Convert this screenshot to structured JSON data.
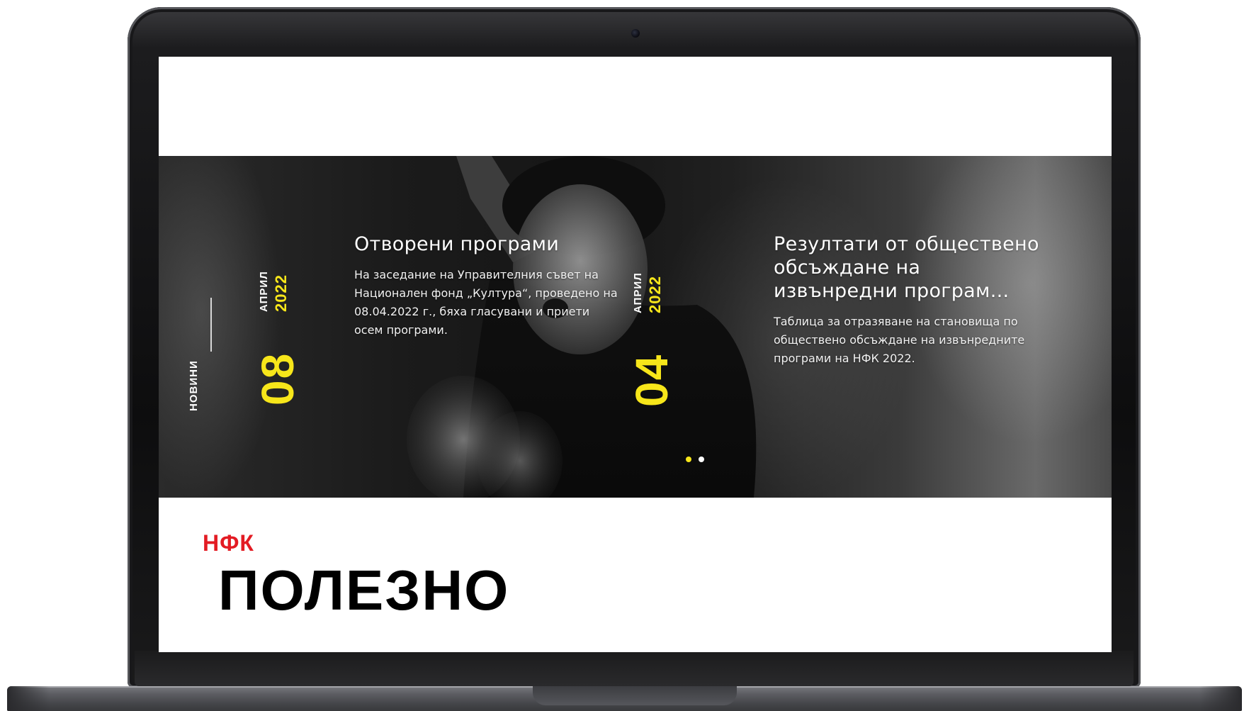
{
  "hero": {
    "section_label": "НОВИНИ",
    "news": [
      {
        "day": "08",
        "month": "АПРИЛ",
        "year": "2022",
        "title": "Отворени програми",
        "text": "На заседание на Управителния съвет на Национален фонд „Култура“, проведено на 08.04.2022 г., бяха гласувани и приети осем програми."
      },
      {
        "day": "04",
        "month": "АПРИЛ",
        "year": "2022",
        "title": "Резултати от обществено обсъждане на извънредни програм...",
        "text": "Таблица за отразяване на становища по обществено обсъждане на извънредните програми на НФК 2022."
      }
    ],
    "carousel": {
      "slides": 2,
      "active_slide": 1
    }
  },
  "useful": {
    "eyebrow": "НФК",
    "title": "ПОЛЕЗНО"
  },
  "colors": {
    "accent_yellow": "#f7e61a",
    "brand_red": "#e31b23",
    "hero_dark": "#1b1b1b"
  }
}
